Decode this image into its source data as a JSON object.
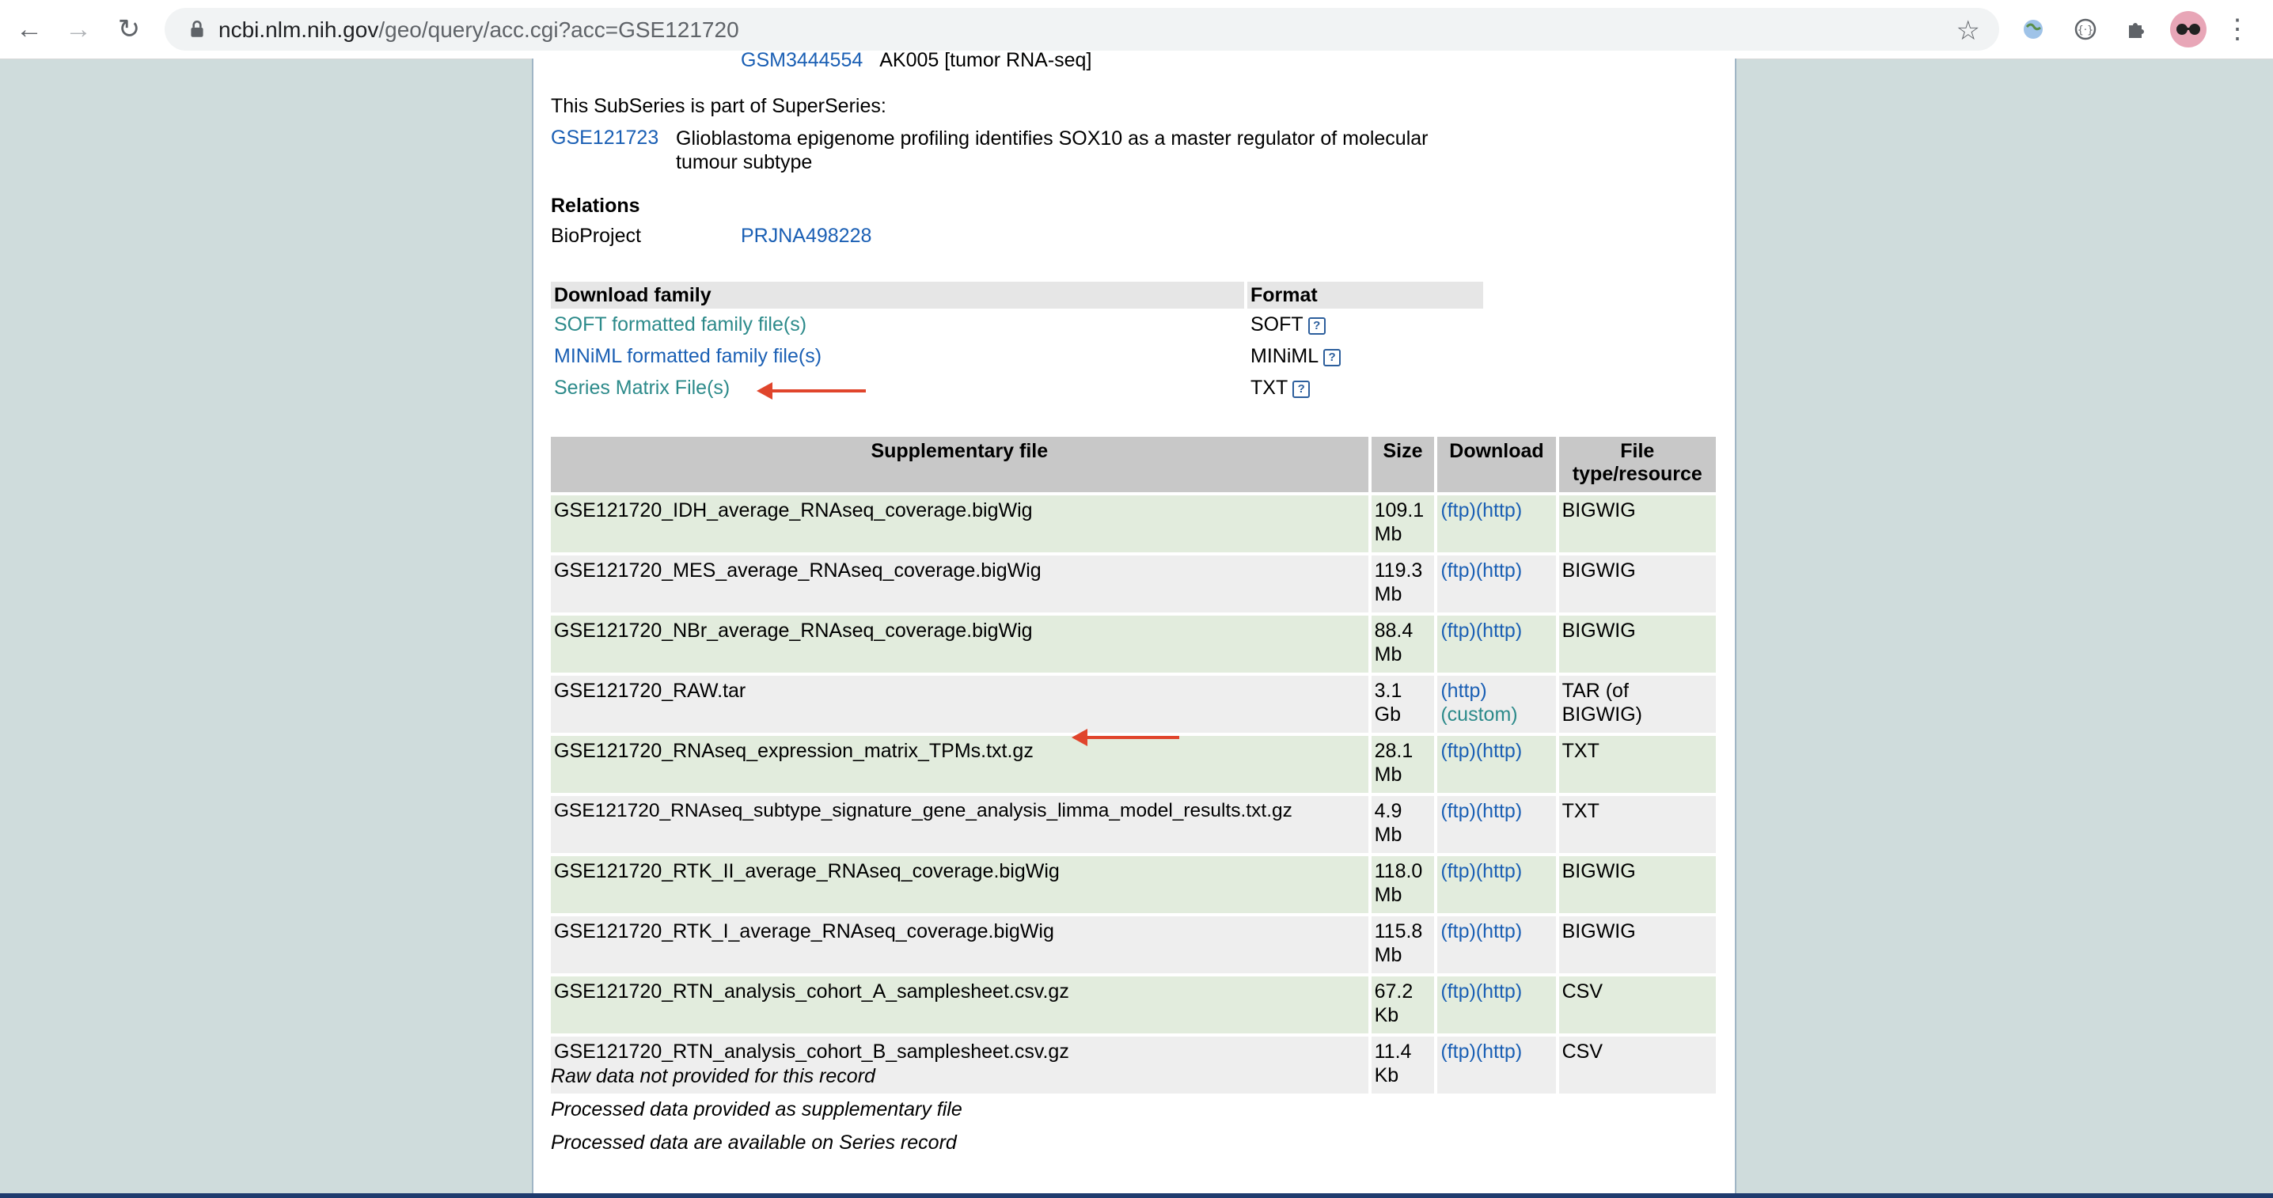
{
  "browser": {
    "url_domain": "ncbi.nlm.nih.gov",
    "url_path": "/geo/query/acc.cgi?acc=GSE121720"
  },
  "page": {
    "top_partial": {
      "accession": "GSM3444554",
      "text": "AK005 [tumor RNA-seq]"
    },
    "superseries": {
      "label": "This SubSeries is part of SuperSeries:",
      "accession": "GSE121723",
      "title": "Glioblastoma epigenome profiling identifies SOX10 as a master regulator of molecular tumour subtype"
    },
    "relations": {
      "heading": "Relations",
      "bioproject_label": "BioProject",
      "bioproject_link": "PRJNA498228"
    },
    "download_family": {
      "header_name": "Download family",
      "header_format": "Format",
      "rows": [
        {
          "name": "SOFT formatted family file(s)",
          "format": "SOFT"
        },
        {
          "name": "MINiML formatted family file(s)",
          "format": "MINiML"
        },
        {
          "name": "Series Matrix File(s)",
          "format": "TXT"
        }
      ]
    },
    "supplementary": {
      "headers": {
        "file": "Supplementary file",
        "size": "Size",
        "download": "Download",
        "type": "File type/resource"
      },
      "rows": [
        {
          "file": "GSE121720_IDH_average_RNAseq_coverage.bigWig",
          "size": "109.1 Mb",
          "dl1": "(ftp)",
          "dl2": "(http)",
          "type": "BIGWIG"
        },
        {
          "file": "GSE121720_MES_average_RNAseq_coverage.bigWig",
          "size": "119.3 Mb",
          "dl1": "(ftp)",
          "dl2": "(http)",
          "type": "BIGWIG"
        },
        {
          "file": "GSE121720_NBr_average_RNAseq_coverage.bigWig",
          "size": "88.4 Mb",
          "dl1": "(ftp)",
          "dl2": "(http)",
          "type": "BIGWIG"
        },
        {
          "file": "GSE121720_RAW.tar",
          "size": "3.1 Gb",
          "dl1": "(http)",
          "dl2": "(custom)",
          "type": "TAR (of BIGWIG)"
        },
        {
          "file": "GSE121720_RNAseq_expression_matrix_TPMs.txt.gz",
          "size": "28.1 Mb",
          "dl1": "(ftp)",
          "dl2": "(http)",
          "type": "TXT"
        },
        {
          "file": "GSE121720_RNAseq_subtype_signature_gene_analysis_limma_model_results.txt.gz",
          "size": "4.9 Mb",
          "dl1": "(ftp)",
          "dl2": "(http)",
          "type": "TXT"
        },
        {
          "file": "GSE121720_RTK_II_average_RNAseq_coverage.bigWig",
          "size": "118.0 Mb",
          "dl1": "(ftp)",
          "dl2": "(http)",
          "type": "BIGWIG"
        },
        {
          "file": "GSE121720_RTK_I_average_RNAseq_coverage.bigWig",
          "size": "115.8 Mb",
          "dl1": "(ftp)",
          "dl2": "(http)",
          "type": "BIGWIG"
        },
        {
          "file": "GSE121720_RTN_analysis_cohort_A_samplesheet.csv.gz",
          "size": "67.2 Kb",
          "dl1": "(ftp)",
          "dl2": "(http)",
          "type": "CSV"
        },
        {
          "file": "GSE121720_RTN_analysis_cohort_B_samplesheet.csv.gz",
          "size": "11.4 Kb",
          "dl1": "(ftp)",
          "dl2": "(http)",
          "type": "CSV"
        }
      ]
    },
    "notes": [
      "Raw data not provided for this record",
      "Processed data provided as supplementary file",
      "Processed data are available on Series record"
    ]
  },
  "colors": {
    "link_blue": "#1a5fb4",
    "link_teal": "#2c8a8a",
    "annotation_arrow": "#e0452c",
    "row_green": "#e2ecdd",
    "row_gray": "#eeeeee"
  }
}
